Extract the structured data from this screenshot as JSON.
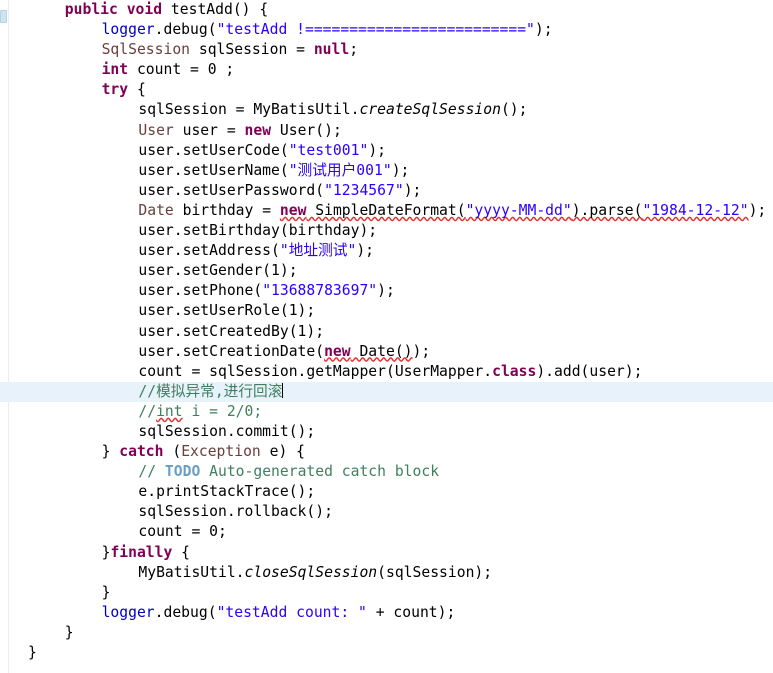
{
  "editor": {
    "language": "java",
    "theme": "eclipse-light",
    "background_color": "#ffffff",
    "current_line_highlight_color": "#e8f2fb",
    "font_size_px": 14.7,
    "line_height_px": 20.1,
    "caret_visible": true,
    "caret_line_index": 19,
    "gutter": {
      "annotation_marker": "overview-ruler-marker",
      "marker_color": "#cfe3f0"
    },
    "colors": {
      "keyword": "#7f0055",
      "string": "#2a00ff",
      "comment": "#3f7f5f",
      "todo_tag": "#6a9ec5",
      "field": "#0000c0",
      "local_variable": "#6a3e3e",
      "plain_text": "#000000",
      "error_squiggle": "#e03030",
      "warning_squiggle": "#c08a2a"
    }
  },
  "code": {
    "lines": [
      {
        "id": "line-01",
        "indent": 4,
        "current": false,
        "tokens": [
          {
            "t": "public",
            "c": "kw"
          },
          {
            "t": " ",
            "c": "plain"
          },
          {
            "t": "void",
            "c": "kw"
          },
          {
            "t": " testAdd() {",
            "c": "plain"
          }
        ]
      },
      {
        "id": "line-02",
        "indent": 8,
        "current": false,
        "tokens": [
          {
            "t": "logger",
            "c": "field"
          },
          {
            "t": ".debug(",
            "c": "plain"
          },
          {
            "t": "\"testAdd !=========================\"",
            "c": "str"
          },
          {
            "t": ");",
            "c": "plain"
          }
        ]
      },
      {
        "id": "line-03",
        "indent": 8,
        "current": false,
        "tokens": [
          {
            "t": "SqlSession",
            "c": "localvar"
          },
          {
            "t": " sqlSession = ",
            "c": "plain"
          },
          {
            "t": "null",
            "c": "kw"
          },
          {
            "t": ";",
            "c": "plain"
          }
        ]
      },
      {
        "id": "line-04",
        "indent": 8,
        "current": false,
        "tokens": [
          {
            "t": "int",
            "c": "kw"
          },
          {
            "t": " count = 0 ;",
            "c": "plain"
          }
        ]
      },
      {
        "id": "line-05",
        "indent": 8,
        "current": false,
        "tokens": [
          {
            "t": "try",
            "c": "kw"
          },
          {
            "t": " {",
            "c": "plain"
          }
        ]
      },
      {
        "id": "line-06",
        "indent": 12,
        "current": false,
        "tokens": [
          {
            "t": "sqlSession = MyBatisUtil.",
            "c": "plain"
          },
          {
            "t": "createSqlSession",
            "c": "static"
          },
          {
            "t": "();",
            "c": "plain"
          }
        ]
      },
      {
        "id": "line-07",
        "indent": 12,
        "current": false,
        "tokens": [
          {
            "t": "User",
            "c": "localvar"
          },
          {
            "t": " user = ",
            "c": "plain"
          },
          {
            "t": "new",
            "c": "kw"
          },
          {
            "t": " User();",
            "c": "plain"
          }
        ]
      },
      {
        "id": "line-08",
        "indent": 12,
        "current": false,
        "tokens": [
          {
            "t": "user.setUserCode(",
            "c": "plain"
          },
          {
            "t": "\"test001\"",
            "c": "str"
          },
          {
            "t": ");",
            "c": "plain"
          }
        ]
      },
      {
        "id": "line-09",
        "indent": 12,
        "current": false,
        "tokens": [
          {
            "t": "user.setUserName(",
            "c": "plain"
          },
          {
            "t": "\"测试用户001\"",
            "c": "str"
          },
          {
            "t": ");",
            "c": "plain"
          }
        ]
      },
      {
        "id": "line-10",
        "indent": 12,
        "current": false,
        "tokens": [
          {
            "t": "user.setUserPassword(",
            "c": "plain"
          },
          {
            "t": "\"1234567\"",
            "c": "str"
          },
          {
            "t": ");",
            "c": "plain"
          }
        ]
      },
      {
        "id": "line-11",
        "indent": 12,
        "current": false,
        "tokens": [
          {
            "t": "Date",
            "c": "localvar"
          },
          {
            "t": " birthday = ",
            "c": "plain"
          },
          {
            "t": "new",
            "c": "kw err"
          },
          {
            "t": " SimpleDateFormat(",
            "c": "plain err"
          },
          {
            "t": "\"yyyy-MM-dd\"",
            "c": "str err"
          },
          {
            "t": ").parse(",
            "c": "plain err"
          },
          {
            "t": "\"1984-12-12\"",
            "c": "str err"
          },
          {
            "t": ");",
            "c": "plain"
          }
        ]
      },
      {
        "id": "line-12",
        "indent": 12,
        "current": false,
        "tokens": [
          {
            "t": "user.setBirthday(birthday);",
            "c": "plain"
          }
        ]
      },
      {
        "id": "line-13",
        "indent": 12,
        "current": false,
        "tokens": [
          {
            "t": "user.setAddress(",
            "c": "plain"
          },
          {
            "t": "\"地址测试\"",
            "c": "str"
          },
          {
            "t": ");",
            "c": "plain"
          }
        ]
      },
      {
        "id": "line-14",
        "indent": 12,
        "current": false,
        "tokens": [
          {
            "t": "user.setGender(1);",
            "c": "plain"
          }
        ]
      },
      {
        "id": "line-15",
        "indent": 12,
        "current": false,
        "tokens": [
          {
            "t": "user.setPhone(",
            "c": "plain"
          },
          {
            "t": "\"13688783697\"",
            "c": "str"
          },
          {
            "t": ");",
            "c": "plain"
          }
        ]
      },
      {
        "id": "line-16",
        "indent": 12,
        "current": false,
        "tokens": [
          {
            "t": "user.setUserRole(1);",
            "c": "plain"
          }
        ]
      },
      {
        "id": "line-17",
        "indent": 12,
        "current": false,
        "tokens": [
          {
            "t": "user.setCreatedBy(1);",
            "c": "plain"
          }
        ]
      },
      {
        "id": "line-18",
        "indent": 12,
        "current": false,
        "tokens": [
          {
            "t": "user.setCreationDate(",
            "c": "plain"
          },
          {
            "t": "new",
            "c": "kw err"
          },
          {
            "t": " Date()",
            "c": "plain err"
          },
          {
            "t": ");",
            "c": "plain"
          }
        ]
      },
      {
        "id": "line-19",
        "indent": 12,
        "current": false,
        "tokens": [
          {
            "t": "count = sqlSession.getMapper(UserMapper.",
            "c": "plain"
          },
          {
            "t": "class",
            "c": "kw"
          },
          {
            "t": ").add(user);",
            "c": "plain"
          }
        ]
      },
      {
        "id": "line-20",
        "indent": 12,
        "current": true,
        "caret": true,
        "tokens": [
          {
            "t": "//模拟异常,进行回滚",
            "c": "cmt"
          }
        ]
      },
      {
        "id": "line-21",
        "indent": 12,
        "current": false,
        "tokens": [
          {
            "t": "//",
            "c": "cmt"
          },
          {
            "t": "int",
            "c": "cmt err"
          },
          {
            "t": " i = 2/0;",
            "c": "cmt"
          }
        ]
      },
      {
        "id": "line-22",
        "indent": 12,
        "current": false,
        "tokens": [
          {
            "t": "sqlSession.commit();",
            "c": "plain"
          }
        ]
      },
      {
        "id": "line-23",
        "indent": 8,
        "current": false,
        "tokens": [
          {
            "t": "} ",
            "c": "plain"
          },
          {
            "t": "catch",
            "c": "kw"
          },
          {
            "t": " (",
            "c": "plain"
          },
          {
            "t": "Exception",
            "c": "localvar"
          },
          {
            "t": " e) {",
            "c": "plain"
          }
        ]
      },
      {
        "id": "line-24",
        "indent": 12,
        "current": false,
        "tokens": [
          {
            "t": "// ",
            "c": "cmt"
          },
          {
            "t": "TODO",
            "c": "todo"
          },
          {
            "t": " Auto-generated catch block",
            "c": "cmt"
          }
        ]
      },
      {
        "id": "line-25",
        "indent": 12,
        "current": false,
        "tokens": [
          {
            "t": "e.printStackTrace();",
            "c": "plain"
          }
        ]
      },
      {
        "id": "line-26",
        "indent": 12,
        "current": false,
        "tokens": [
          {
            "t": "sqlSession.rollback();",
            "c": "plain"
          }
        ]
      },
      {
        "id": "line-27",
        "indent": 12,
        "current": false,
        "tokens": [
          {
            "t": "count = 0;",
            "c": "plain"
          }
        ]
      },
      {
        "id": "line-28",
        "indent": 8,
        "current": false,
        "tokens": [
          {
            "t": "}",
            "c": "plain"
          },
          {
            "t": "finally",
            "c": "kw"
          },
          {
            "t": " {",
            "c": "plain"
          }
        ]
      },
      {
        "id": "line-29",
        "indent": 12,
        "current": false,
        "tokens": [
          {
            "t": "MyBatisUtil.",
            "c": "plain"
          },
          {
            "t": "closeSqlSession",
            "c": "static"
          },
          {
            "t": "(sqlSession);",
            "c": "plain"
          }
        ]
      },
      {
        "id": "line-30",
        "indent": 8,
        "current": false,
        "tokens": [
          {
            "t": "}",
            "c": "plain"
          }
        ]
      },
      {
        "id": "line-31",
        "indent": 8,
        "current": false,
        "tokens": [
          {
            "t": "logger",
            "c": "field"
          },
          {
            "t": ".debug(",
            "c": "plain"
          },
          {
            "t": "\"testAdd count: \"",
            "c": "str"
          },
          {
            "t": " + count);",
            "c": "plain"
          }
        ]
      },
      {
        "id": "line-32",
        "indent": 4,
        "current": false,
        "tokens": [
          {
            "t": "}",
            "c": "plain"
          }
        ]
      },
      {
        "id": "line-33",
        "indent": 0,
        "current": false,
        "tokens": [
          {
            "t": "}",
            "c": "plain"
          }
        ]
      }
    ]
  }
}
